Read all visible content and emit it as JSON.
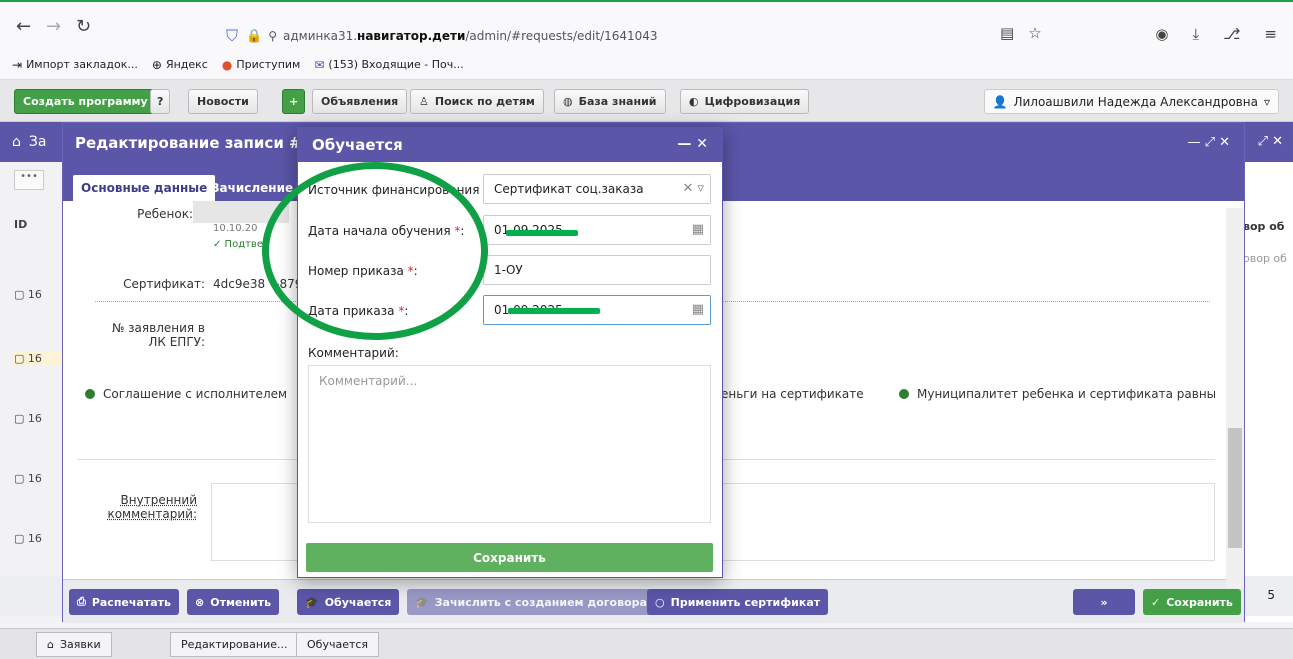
{
  "browser": {
    "url_prefix": "админка31.",
    "url_host": "навигатор.дети",
    "url_path": "/admin/#requests/edit/1641043",
    "bookmarks": [
      {
        "icon": "import-icon",
        "label": "Импорт закладок..."
      },
      {
        "icon": "globe-icon",
        "label": "Яндекс"
      },
      {
        "icon": "dot-icon",
        "label": "Приступим"
      },
      {
        "icon": "mail-icon",
        "label": "(153) Входящие - Поч..."
      }
    ]
  },
  "toolbar": {
    "create_program": "Создать программу",
    "news": "Новости",
    "announcements": "Объявления",
    "search_children": "Поиск по детям",
    "knowledge_base": "База знаний",
    "digitalization": "Цифровизация",
    "user_name": "Лилоашвили Надежда Александровна"
  },
  "back_window": {
    "title": "За",
    "row_ids": [
      "16",
      "16",
      "16",
      "16",
      "16"
    ],
    "right_header": "вор об",
    "right_sub": "овор об",
    "page_num": "5"
  },
  "edit_window": {
    "title": "Редактирование записи #16",
    "tab_main": "Основные данные",
    "tab_enroll": "Зачисление",
    "child_label": "Ребенок:",
    "date_text": "10.10.20",
    "confirmed_text": "✓ Подтве",
    "certificate_label": "Сертификат:",
    "certificate_value": "4dc9e38",
    "certificate_value_tail": "-879",
    "epgu_label_1": "№ заявления в",
    "epgu_label_2": "ЛК ЕПГУ:",
    "check_agreement": "Соглашение с исполнителем",
    "check_money": "еньги на сертификате",
    "check_municipality": "Муниципалитет ребенка и сертификата равны",
    "internal_comment_1": "Внутренний",
    "internal_comment_2": "комментарий:",
    "footer": {
      "print": "Распечатать",
      "cancel": "Отменить",
      "studying": "Обучается",
      "enroll_contract": "Зачислить с созданием договора",
      "apply_certificate": "Применить сертификат",
      "save": "Сохранить"
    }
  },
  "modal": {
    "title": "Обучается",
    "funding_label": "Источник финансирования",
    "funding_value": "Сертификат соц.заказа",
    "start_date_label": "Дата начала обучения",
    "start_date_value": "01.09.2025",
    "order_number_label": "Номер приказа",
    "order_number_value": "1-ОУ",
    "order_date_label": "Дата приказа",
    "order_date_value": "01.09.2025",
    "comment_label": "Комментарий:",
    "comment_placeholder": "Комментарий...",
    "save": "Сохранить"
  },
  "taskbar": {
    "requests": "Заявки",
    "editing": "Редактирование...",
    "studying": "Обучается"
  },
  "colors": {
    "accent": "#5b56a8",
    "save_green": "#43a047",
    "annotation_green": "#10a045"
  }
}
